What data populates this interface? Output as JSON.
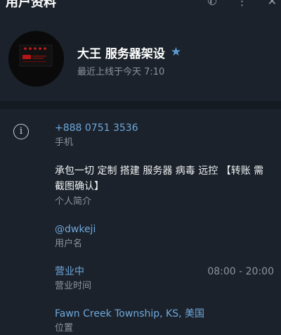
{
  "header": {
    "title": "用户资料",
    "icons": [
      "call-icon",
      "more-icon",
      "close-icon"
    ]
  },
  "profile": {
    "name": "大王 服务器架设",
    "verified_icon": "star-icon",
    "last_seen": "最近上线于今天 7:10"
  },
  "info": {
    "icon": "info-icon",
    "phone": {
      "value": "+888 0751 3536",
      "label": "手机"
    },
    "bio": {
      "value": "承包一切 定制 搭建 服务器 病毒 远控 【转账 需 截图确认】",
      "label": "个人简介"
    },
    "username": {
      "value": "@dwkeji",
      "label": "用户名"
    },
    "business_hours": {
      "status": "营业中",
      "hours": "08:00 - 20:00",
      "label": "营业时间"
    },
    "location": {
      "value": "Fawn Creek Township, KS, 美国",
      "label": "位置"
    }
  },
  "colors": {
    "background": "#1b222b",
    "link": "#6fa8dc",
    "muted": "#8b949e",
    "verified": "#5b9bd5"
  }
}
